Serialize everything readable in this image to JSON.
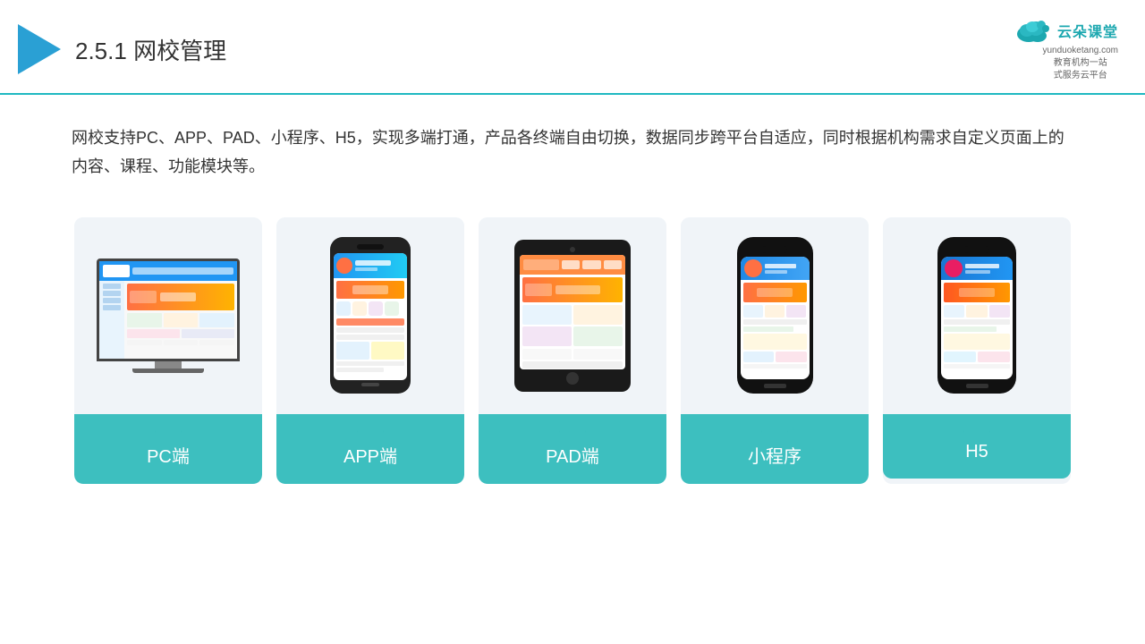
{
  "header": {
    "section_number": "2.5.1",
    "title": "网校管理",
    "brand_name": "云朵课堂",
    "brand_url": "yunduoketang.com",
    "brand_tagline_line1": "教育机构一站",
    "brand_tagline_line2": "式服务云平台"
  },
  "description": {
    "text": "网校支持PC、APP、PAD、小程序、H5，实现多端打通，产品各终端自由切换，数据同步跨平台自适应，同时根据机构需求自定义页面上的内容、课程、功能模块等。"
  },
  "cards": [
    {
      "id": "pc",
      "label": "PC端"
    },
    {
      "id": "app",
      "label": "APP端"
    },
    {
      "id": "pad",
      "label": "PAD端"
    },
    {
      "id": "miniprogram",
      "label": "小程序"
    },
    {
      "id": "h5",
      "label": "H5"
    }
  ]
}
